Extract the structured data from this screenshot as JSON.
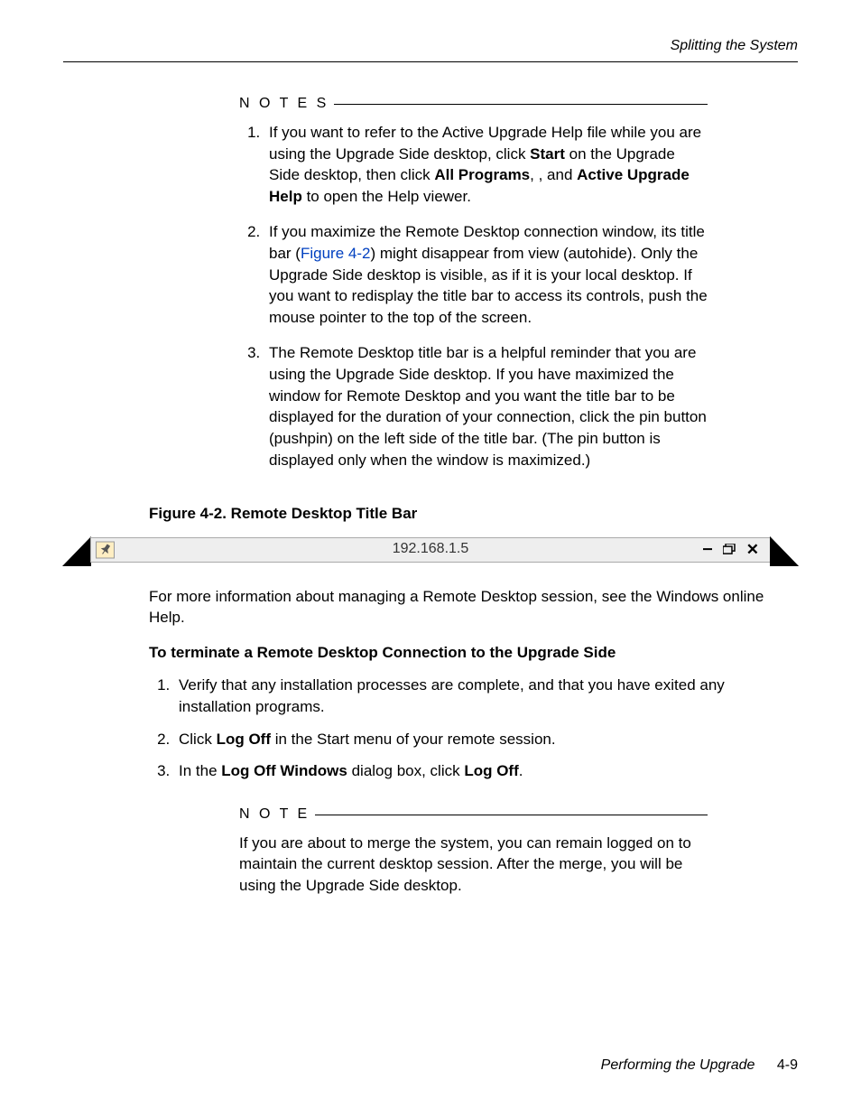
{
  "header": {
    "running_title": "Splitting the System"
  },
  "notes": {
    "label": "N O T E S",
    "items": [
      {
        "pre": "If you want to refer to the Active Upgrade Help file while you are using the Upgrade Side desktop, click ",
        "b1": "Start",
        "mid1": " on the Upgrade Side desktop, then click ",
        "b2": "All Programs",
        "mid2": ",          , and ",
        "b3": "Active Upgrade Help",
        "post": " to open the Help viewer."
      },
      {
        "pre": "If you maximize the Remote Desktop connection window, its title bar (",
        "link": "Figure 4-2",
        "post": ") might disappear from view (autohide). Only the Upgrade Side desktop is visible, as if it is your local desktop. If you want to redisplay the title bar to access its controls, push the mouse pointer to the top of the screen."
      },
      {
        "text": "The Remote Desktop title bar is a helpful reminder that you are using the Upgrade Side desktop. If you have maximized the window for Remote Desktop and you want the title bar to be displayed for the duration of your connection, click the pin button (pushpin) on the left side of the title bar. (The pin button is displayed only when the window is maximized.)"
      }
    ]
  },
  "figure": {
    "caption": "Figure 4-2. Remote Desktop Title Bar",
    "ip": "192.168.1.5"
  },
  "body": {
    "para1": "For more information about managing a Remote Desktop session, see the Windows online Help.",
    "subhead": "To terminate a Remote Desktop Connection to the Upgrade Side",
    "steps": [
      {
        "text": "Verify that any installation processes are complete, and that you have exited any installation programs."
      },
      {
        "pre": "Click ",
        "b1": "Log Off",
        "post": " in the Start menu of your remote session."
      },
      {
        "pre": "In the ",
        "b1": "Log Off Windows",
        "mid": " dialog box, click ",
        "b2": "Log Off",
        "post": "."
      }
    ]
  },
  "note_single": {
    "label": "N O T E",
    "text": "If you are about to merge the system, you can remain logged on to maintain the current desktop session. After the merge, you will be using the Upgrade Side desktop."
  },
  "footer": {
    "chapter": "Performing the Upgrade",
    "page": "4-9"
  }
}
